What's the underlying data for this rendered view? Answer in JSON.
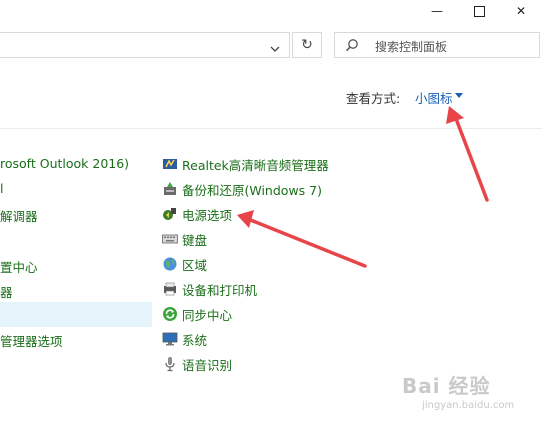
{
  "window": {
    "minimize_glyph": "—",
    "close_glyph": "✕"
  },
  "address": {
    "search_placeholder": "搜索控制面板",
    "refresh_glyph": "↻"
  },
  "view": {
    "label": "查看方式:",
    "value": "小图标"
  },
  "left_items": [
    {
      "label": "rosoft Outlook 2016)"
    },
    {
      "label": "l"
    },
    {
      "label": "解调器"
    },
    {
      "label": "置中心"
    },
    {
      "label": "器"
    },
    {
      "label": "管理器选项"
    }
  ],
  "right_items": [
    {
      "label": "Realtek高清晰音频管理器",
      "icon": "realtek-audio-icon"
    },
    {
      "label": "备份和还原(Windows 7)",
      "icon": "backup-restore-icon"
    },
    {
      "label": "电源选项",
      "icon": "power-options-icon"
    },
    {
      "label": "键盘",
      "icon": "keyboard-icon"
    },
    {
      "label": "区域",
      "icon": "region-icon"
    },
    {
      "label": "设备和打印机",
      "icon": "devices-printers-icon"
    },
    {
      "label": "同步中心",
      "icon": "sync-center-icon"
    },
    {
      "label": "系统",
      "icon": "system-icon"
    },
    {
      "label": "语音识别",
      "icon": "speech-recognition-icon"
    }
  ],
  "watermark": {
    "brand": "Bai 经验",
    "url": "jingyan.baidu.com"
  }
}
